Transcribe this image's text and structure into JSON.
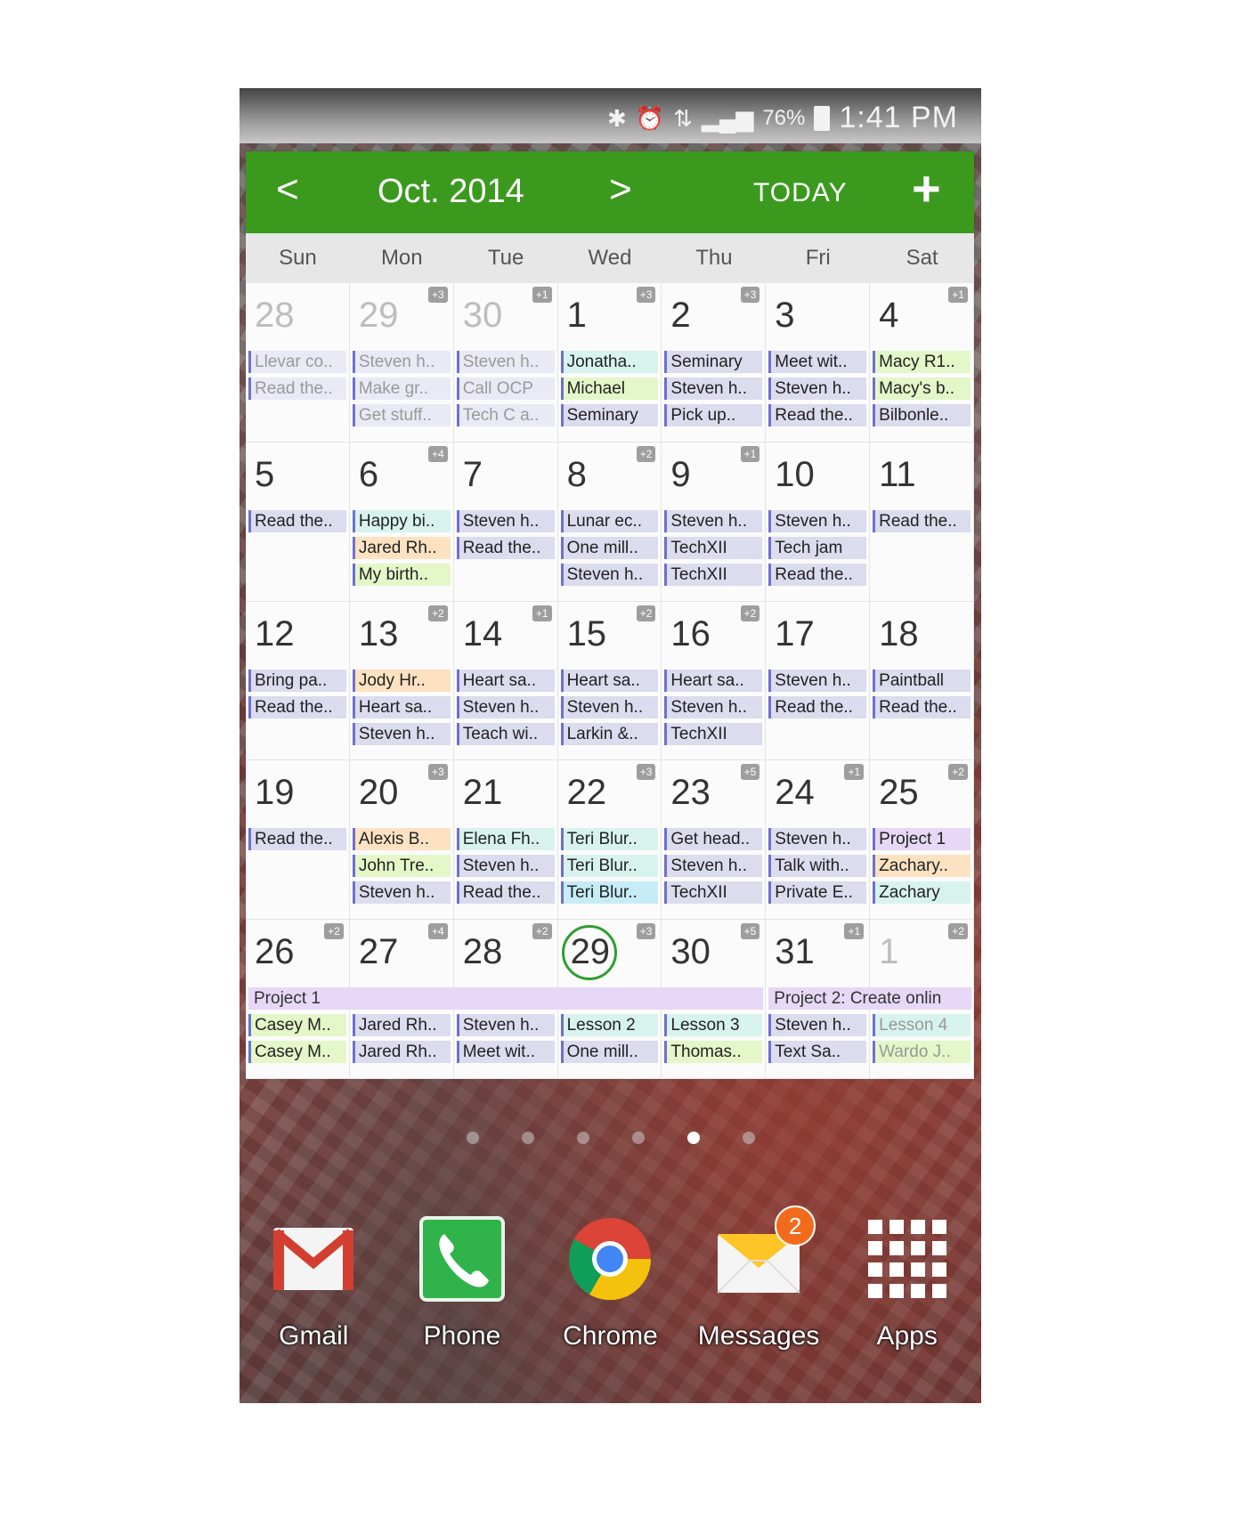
{
  "status_bar": {
    "battery": "76%",
    "time": "1:41 PM"
  },
  "calendar": {
    "month_title": "Oct. 2014",
    "prev_glyph": "<",
    "next_glyph": ">",
    "today_label": "TODAY",
    "add_glyph": "+",
    "weekdays": [
      "Sun",
      "Mon",
      "Tue",
      "Wed",
      "Thu",
      "Fri",
      "Sat"
    ],
    "today_date": "29",
    "colors": {
      "header": "#3b9a1e",
      "today_ring": "#2f9e2f"
    },
    "weeks": [
      [
        {
          "day": "28",
          "other": true,
          "more": "",
          "events": [
            {
              "t": "Llevar co..",
              "c": "#eaeaf6"
            },
            {
              "t": "Read the..",
              "c": "#eaeaf6"
            }
          ]
        },
        {
          "day": "29",
          "other": true,
          "more": "+3",
          "events": [
            {
              "t": "Steven h..",
              "c": "#eaeaf6"
            },
            {
              "t": "Make gr..",
              "c": "#eaeaf6"
            },
            {
              "t": "Get stuff..",
              "c": "#eaeaf6"
            }
          ]
        },
        {
          "day": "30",
          "other": true,
          "more": "+1",
          "events": [
            {
              "t": "Steven h..",
              "c": "#eaeaf6"
            },
            {
              "t": "Call OCP",
              "c": "#eaeaf6"
            },
            {
              "t": "Tech C a..",
              "c": "#eaeaf6"
            }
          ]
        },
        {
          "day": "1",
          "other": false,
          "more": "+3",
          "events": [
            {
              "t": "Jonatha..",
              "c": "#d8f3ee"
            },
            {
              "t": "Michael",
              "c": "#e3f7c8"
            },
            {
              "t": "Seminary",
              "c": "#dcdcef"
            }
          ]
        },
        {
          "day": "2",
          "other": false,
          "more": "+3",
          "events": [
            {
              "t": "Seminary",
              "c": "#dcdcef"
            },
            {
              "t": "Steven h..",
              "c": "#dcdcef"
            },
            {
              "t": "Pick up..",
              "c": "#dcdcef"
            }
          ]
        },
        {
          "day": "3",
          "other": false,
          "more": "",
          "events": [
            {
              "t": "Meet wit..",
              "c": "#dcdcef"
            },
            {
              "t": "Steven h..",
              "c": "#dcdcef"
            },
            {
              "t": "Read the..",
              "c": "#dcdcef"
            }
          ]
        },
        {
          "day": "4",
          "other": false,
          "more": "+1",
          "events": [
            {
              "t": "Macy R1..",
              "c": "#e3f7c8"
            },
            {
              "t": "Macy's b..",
              "c": "#e3f7c8"
            },
            {
              "t": "Bilbonle..",
              "c": "#dcdcef"
            }
          ]
        }
      ],
      [
        {
          "day": "5",
          "other": false,
          "more": "",
          "events": [
            {
              "t": "Read the..",
              "c": "#dcdcef"
            }
          ]
        },
        {
          "day": "6",
          "other": false,
          "more": "+4",
          "events": [
            {
              "t": "Happy bi..",
              "c": "#d8f3ee"
            },
            {
              "t": "Jared Rh..",
              "c": "#fde2c2"
            },
            {
              "t": "My birth..",
              "c": "#e3f7c8"
            }
          ]
        },
        {
          "day": "7",
          "other": false,
          "more": "",
          "events": [
            {
              "t": "Steven h..",
              "c": "#dcdcef"
            },
            {
              "t": "Read the..",
              "c": "#dcdcef"
            }
          ]
        },
        {
          "day": "8",
          "other": false,
          "more": "+2",
          "events": [
            {
              "t": "Lunar ec..",
              "c": "#dcdcef"
            },
            {
              "t": "One mill..",
              "c": "#dcdcef"
            },
            {
              "t": "Steven h..",
              "c": "#dcdcef"
            }
          ]
        },
        {
          "day": "9",
          "other": false,
          "more": "+1",
          "events": [
            {
              "t": "Steven h..",
              "c": "#dcdcef"
            },
            {
              "t": "TechXII",
              "c": "#dcdcef"
            },
            {
              "t": "TechXII",
              "c": "#dcdcef"
            }
          ]
        },
        {
          "day": "10",
          "other": false,
          "more": "",
          "events": [
            {
              "t": "Steven h..",
              "c": "#dcdcef"
            },
            {
              "t": "Tech jam",
              "c": "#dcdcef"
            },
            {
              "t": "Read the..",
              "c": "#dcdcef"
            }
          ]
        },
        {
          "day": "11",
          "other": false,
          "more": "",
          "events": [
            {
              "t": "Read the..",
              "c": "#dcdcef"
            }
          ]
        }
      ],
      [
        {
          "day": "12",
          "other": false,
          "more": "",
          "events": [
            {
              "t": "Bring pa..",
              "c": "#dcdcef"
            },
            {
              "t": "Read the..",
              "c": "#dcdcef"
            }
          ]
        },
        {
          "day": "13",
          "other": false,
          "more": "+2",
          "events": [
            {
              "t": "Jody Hr..",
              "c": "#fde2c2"
            },
            {
              "t": "Heart sa..",
              "c": "#dcdcef"
            },
            {
              "t": "Steven h..",
              "c": "#dcdcef"
            }
          ]
        },
        {
          "day": "14",
          "other": false,
          "more": "+1",
          "events": [
            {
              "t": "Heart sa..",
              "c": "#dcdcef"
            },
            {
              "t": "Steven h..",
              "c": "#dcdcef"
            },
            {
              "t": "Teach wi..",
              "c": "#dcdcef"
            }
          ]
        },
        {
          "day": "15",
          "other": false,
          "more": "+2",
          "events": [
            {
              "t": "Heart sa..",
              "c": "#dcdcef"
            },
            {
              "t": "Steven h..",
              "c": "#dcdcef"
            },
            {
              "t": "Larkin &..",
              "c": "#dcdcef"
            }
          ]
        },
        {
          "day": "16",
          "other": false,
          "more": "+2",
          "events": [
            {
              "t": "Heart sa..",
              "c": "#dcdcef"
            },
            {
              "t": "Steven h..",
              "c": "#dcdcef"
            },
            {
              "t": "TechXII",
              "c": "#dcdcef"
            }
          ]
        },
        {
          "day": "17",
          "other": false,
          "more": "",
          "events": [
            {
              "t": "Steven h..",
              "c": "#dcdcef"
            },
            {
              "t": "Read the..",
              "c": "#dcdcef"
            }
          ]
        },
        {
          "day": "18",
          "other": false,
          "more": "",
          "events": [
            {
              "t": "Paintball",
              "c": "#dcdcef"
            },
            {
              "t": "Read the..",
              "c": "#dcdcef"
            }
          ]
        }
      ],
      [
        {
          "day": "19",
          "other": false,
          "more": "",
          "events": [
            {
              "t": "Read the..",
              "c": "#dcdcef"
            }
          ]
        },
        {
          "day": "20",
          "other": false,
          "more": "+3",
          "events": [
            {
              "t": "Alexis B..",
              "c": "#fde2c2"
            },
            {
              "t": "John Tre..",
              "c": "#e3f7c8"
            },
            {
              "t": "Steven h..",
              "c": "#dcdcef"
            }
          ]
        },
        {
          "day": "21",
          "other": false,
          "more": "",
          "events": [
            {
              "t": "Elena Fh..",
              "c": "#d8f3ee"
            },
            {
              "t": "Steven h..",
              "c": "#dcdcef"
            },
            {
              "t": "Read the..",
              "c": "#dcdcef"
            }
          ]
        },
        {
          "day": "22",
          "other": false,
          "more": "+3",
          "events": [
            {
              "t": "Teri Blur..",
              "c": "#d8f3ee"
            },
            {
              "t": "Teri Blur..",
              "c": "#d8f3ee"
            },
            {
              "t": "Teri Blur..",
              "c": "#c6ecf7"
            }
          ]
        },
        {
          "day": "23",
          "other": false,
          "more": "+5",
          "events": [
            {
              "t": "Get head..",
              "c": "#dcdcef"
            },
            {
              "t": "Steven h..",
              "c": "#dcdcef"
            },
            {
              "t": "TechXII",
              "c": "#dcdcef"
            }
          ]
        },
        {
          "day": "24",
          "other": false,
          "more": "+1",
          "events": [
            {
              "t": "Steven h..",
              "c": "#dcdcef"
            },
            {
              "t": "Talk with..",
              "c": "#dcdcef"
            },
            {
              "t": "Private E..",
              "c": "#dcdcef"
            }
          ]
        },
        {
          "day": "25",
          "other": false,
          "more": "+2",
          "events": [
            {
              "t": "Project 1",
              "c": "#e6d8f6"
            },
            {
              "t": "Zachary..",
              "c": "#fde2c2"
            },
            {
              "t": "Zachary",
              "c": "#d8f3ee"
            }
          ]
        }
      ],
      [
        {
          "day": "26",
          "other": false,
          "more": "+2",
          "events": [
            {
              "t": "Casey M..",
              "c": "#e3f7c8"
            },
            {
              "t": "Casey M..",
              "c": "#e3f7c8"
            }
          ]
        },
        {
          "day": "27",
          "other": false,
          "more": "+4",
          "events": [
            {
              "t": "Jared Rh..",
              "c": "#dcdcef"
            },
            {
              "t": "Jared Rh..",
              "c": "#dcdcef"
            }
          ]
        },
        {
          "day": "28",
          "other": false,
          "more": "+2",
          "events": [
            {
              "t": "Steven h..",
              "c": "#dcdcef"
            },
            {
              "t": "Meet wit..",
              "c": "#dcdcef"
            }
          ]
        },
        {
          "day": "29",
          "other": false,
          "more": "+3",
          "events": [
            {
              "t": "Lesson 2",
              "c": "#d8f3ee"
            },
            {
              "t": "One mill..",
              "c": "#dcdcef"
            }
          ]
        },
        {
          "day": "30",
          "other": false,
          "more": "+5",
          "events": [
            {
              "t": "Lesson 3",
              "c": "#d8f3ee"
            },
            {
              "t": "Thomas..",
              "c": "#e3f7c8"
            }
          ]
        },
        {
          "day": "31",
          "other": false,
          "more": "+1",
          "events": [
            {
              "t": "Steven h..",
              "c": "#dcdcef"
            },
            {
              "t": "Text Sa..",
              "c": "#dcdcef"
            }
          ]
        },
        {
          "day": "1",
          "other": true,
          "more": "+2",
          "events": [
            {
              "t": "Lesson 4",
              "c": "#d8f3ee"
            },
            {
              "t": "Wardo J..",
              "c": "#e3f7c8"
            }
          ]
        }
      ]
    ],
    "spanning_events": [
      {
        "label": "Project 1",
        "color": "#e6d8f6"
      },
      {
        "label": "Project 2: Create onlin",
        "color": "#e6d8f6"
      }
    ]
  },
  "dock": {
    "apps": [
      {
        "label": "Gmail",
        "icon": "gmail-icon"
      },
      {
        "label": "Phone",
        "icon": "phone-icon"
      },
      {
        "label": "Chrome",
        "icon": "chrome-icon"
      },
      {
        "label": "Messages",
        "icon": "messages-icon",
        "badge": "2"
      },
      {
        "label": "Apps",
        "icon": "apps-grid-icon"
      }
    ]
  }
}
